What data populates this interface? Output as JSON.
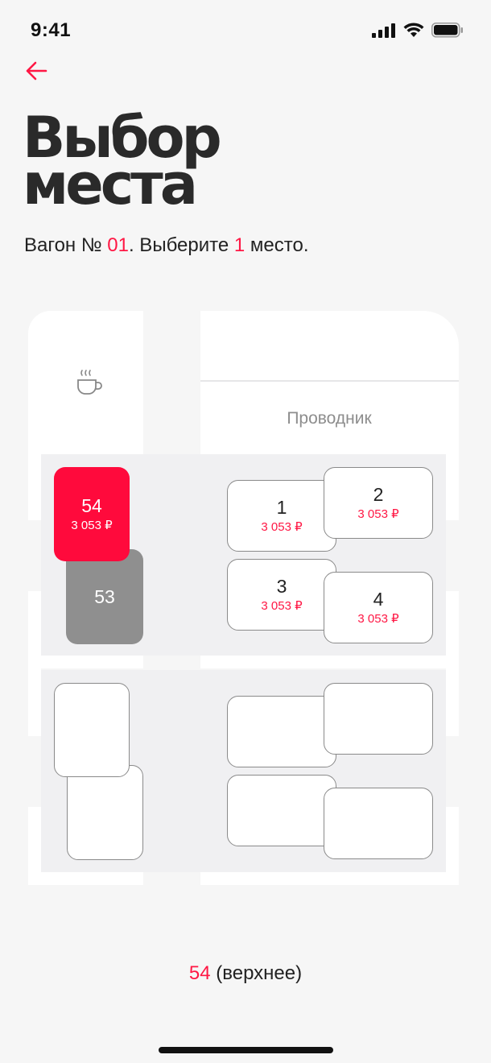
{
  "status_bar": {
    "time": "9:41",
    "signal_icon": "signal-icon",
    "wifi_icon": "wifi-icon",
    "battery_icon": "battery-icon"
  },
  "header": {
    "back_icon": "arrow-left-icon",
    "title_line1": "Выбор",
    "title_line2": "места"
  },
  "subtitle": {
    "prefix": "Вагон № ",
    "car_number": "01",
    "middle": ". Выберите ",
    "count": "1",
    "suffix": " место."
  },
  "car": {
    "amenity_icon": "coffee-cup-icon",
    "conductor_label": "Проводник",
    "compartment_1": {
      "seats": [
        {
          "number": "54",
          "price": "3 053 ₽",
          "state": "selected"
        },
        {
          "number": "53",
          "price": "",
          "state": "taken"
        },
        {
          "number": "1",
          "price": "3 053 ₽",
          "state": "available"
        },
        {
          "number": "2",
          "price": "3 053 ₽",
          "state": "available"
        },
        {
          "number": "3",
          "price": "3 053 ₽",
          "state": "available"
        },
        {
          "number": "4",
          "price": "3 053 ₽",
          "state": "available"
        }
      ]
    }
  },
  "selection": {
    "seat": "54",
    "type": " (верхнее)"
  },
  "colors": {
    "accent": "#ff0a3c",
    "taken": "#8f8f8f",
    "background": "#f6f6f6"
  }
}
